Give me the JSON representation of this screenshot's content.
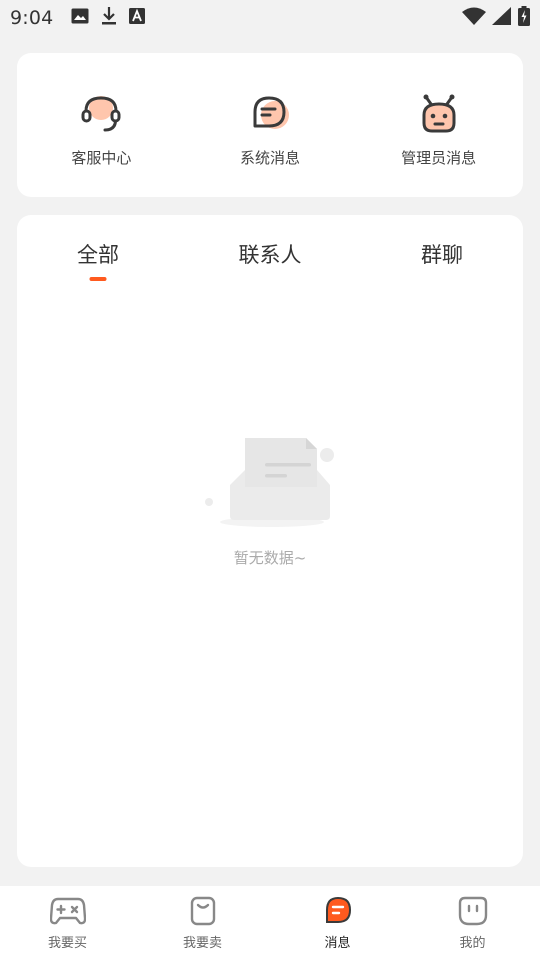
{
  "status_bar": {
    "time": "9:04",
    "left_icons": [
      "image-icon",
      "download-icon",
      "font-icon"
    ],
    "right_icons": [
      "wifi-icon",
      "signal-icon",
      "battery-charging-icon"
    ]
  },
  "quick_actions": [
    {
      "label": "客服中心",
      "icon": "headset-icon"
    },
    {
      "label": "系统消息",
      "icon": "message-bubble-icon"
    },
    {
      "label": "管理员消息",
      "icon": "robot-icon"
    }
  ],
  "tabs": [
    {
      "label": "全部",
      "active": true
    },
    {
      "label": "联系人",
      "active": false
    },
    {
      "label": "群聊",
      "active": false
    }
  ],
  "empty_state": {
    "text": "暂无数据~",
    "icon": "empty-document-icon"
  },
  "bottom_nav": [
    {
      "label": "我要买",
      "icon": "gamepad-icon",
      "active": false
    },
    {
      "label": "我要卖",
      "icon": "bag-icon",
      "active": false
    },
    {
      "label": "消息",
      "icon": "message-icon",
      "active": true
    },
    {
      "label": "我的",
      "icon": "profile-icon",
      "active": false
    }
  ],
  "colors": {
    "accent": "#ff5a1f",
    "accent_soft": "#ffc6ad",
    "icon_dark": "#3a3a3a",
    "background": "#f2f2f2"
  }
}
